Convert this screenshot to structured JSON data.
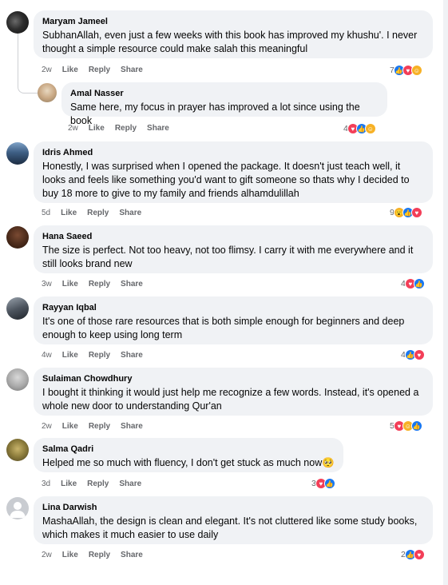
{
  "actions": {
    "like": "Like",
    "reply": "Reply",
    "share": "Share"
  },
  "comments": [
    {
      "author": "Maryam Jameel",
      "text": "SubhanAllah, even just a few weeks with this book has improved my khushu'. I never thought a simple resource could make salah this meaningful",
      "time": "2w",
      "count": "7",
      "reactions": [
        "like",
        "love",
        "care"
      ]
    },
    {
      "author": "Amal Nasser",
      "text": "Same here, my focus in prayer has improved a lot since using the book",
      "time": "2w",
      "count": "4",
      "reactions": [
        "love",
        "like",
        "care"
      ]
    },
    {
      "author": "Idris Ahmed",
      "text": "Honestly, I was surprised when I opened the package. It doesn't just teach well, it looks and feels like something you'd want to gift someone so thats why I decided to buy 18 more to give to my family and friends alhamdulillah",
      "time": "5d",
      "count": "9",
      "reactions": [
        "wow",
        "like",
        "love"
      ]
    },
    {
      "author": "Hana Saeed",
      "text": "The size is perfect. Not too heavy, not too flimsy. I carry it with me everywhere and it still looks brand new",
      "time": "3w",
      "count": "4",
      "reactions": [
        "love",
        "like"
      ]
    },
    {
      "author": "Rayyan Iqbal",
      "text": "It's one of those rare resources that is both simple enough for beginners and deep enough to keep using long term",
      "time": "4w",
      "count": "4",
      "reactions": [
        "like",
        "love"
      ]
    },
    {
      "author": "Sulaiman Chowdhury",
      "text": "I bought it thinking it would just help me recognize a few words. Instead, it's opened a whole new door to understanding Qur'an",
      "time": "2w",
      "count": "5",
      "reactions": [
        "love",
        "care",
        "like"
      ]
    },
    {
      "author": "Salma Qadri",
      "text": "Helped me so much with fluency, I don't get stuck as much now🥺",
      "time": "3d",
      "count": "3",
      "reactions": [
        "love",
        "like"
      ]
    },
    {
      "author": "Lina Darwish",
      "text": "MashaAllah, the design is clean and elegant. It's not cluttered like some study books, which makes it much easier to use daily",
      "time": "2w",
      "count": "2",
      "reactions": [
        "like",
        "love"
      ]
    }
  ],
  "colors": {
    "like": "#1877f2",
    "love": "#f33e58",
    "care": "#f7b125",
    "bubble": "#f0f2f5",
    "meta": "#65676b"
  }
}
